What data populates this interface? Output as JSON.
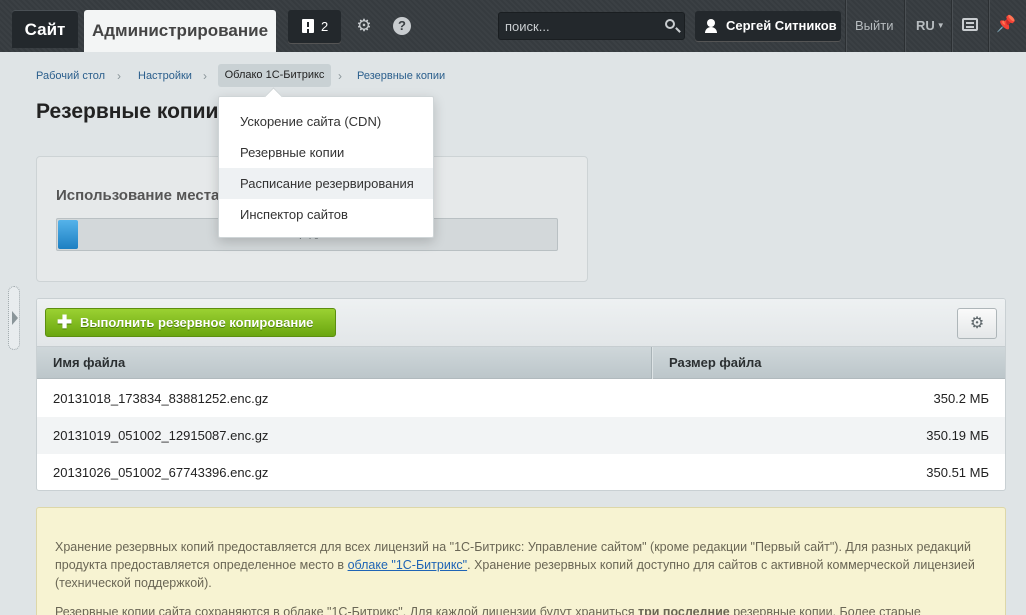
{
  "topbar": {
    "site_tab": "Сайт",
    "admin_tab": "Администрирование",
    "notifications_count": "2",
    "search_placeholder": "поиск...",
    "user_name": "Сергей Ситников",
    "logout": "Выйти",
    "lang": "RU",
    "icons": [
      "flag-icon",
      "gear-icon",
      "help-icon",
      "search-icon",
      "user-icon",
      "keyboard-icon",
      "pin-icon"
    ]
  },
  "breadcrumb": {
    "items": [
      "Рабочий стол",
      "Настройки",
      "Облако 1С-Битрикс",
      "Резервные копии"
    ]
  },
  "page_title": "Резервные копии",
  "usage": {
    "label": "Использование места:",
    "percent_text": "4 %",
    "percent": 4,
    "fill_color": "#1d7fc2"
  },
  "menu": {
    "items": [
      "Ускорение сайта (CDN)",
      "Резервные копии",
      "Расписание резервирования",
      "Инспектор сайтов"
    ],
    "hovered_index": 2
  },
  "grid": {
    "run_button": "Выполнить резервное копирование",
    "columns": [
      "Имя файла",
      "Размер файла"
    ],
    "rows": [
      {
        "name": "20131018_173834_83881252.enc.gz",
        "size": "350.2 МБ"
      },
      {
        "name": "20131019_051002_12915087.enc.gz",
        "size": "350.19 МБ"
      },
      {
        "name": "20131026_051002_67743396.enc.gz",
        "size": "350.51 МБ"
      }
    ],
    "accent_color": "#6aa60f"
  },
  "info": {
    "p1_a": "Хранение резервных копий предоставляется для всех лицензий на \"1С-Битрикс: Управление сайтом\" (кроме редакции \"Первый сайт\"). Для разных редакций продукта предоставляется определенное место в ",
    "p1_link": "облаке \"1С-Битрикс\"",
    "p1_b": ". Хранение резервных копий доступно для сайтов с активной коммерческой лицензией (технической поддержкой).",
    "p2_a": "Резервные копии сайта сохраняются в облаке \"1С-Битрикс\". Для каждой лицензии будут храниться ",
    "p2_bold": "три последние",
    "p2_b": " резервные копии. Более старые"
  }
}
